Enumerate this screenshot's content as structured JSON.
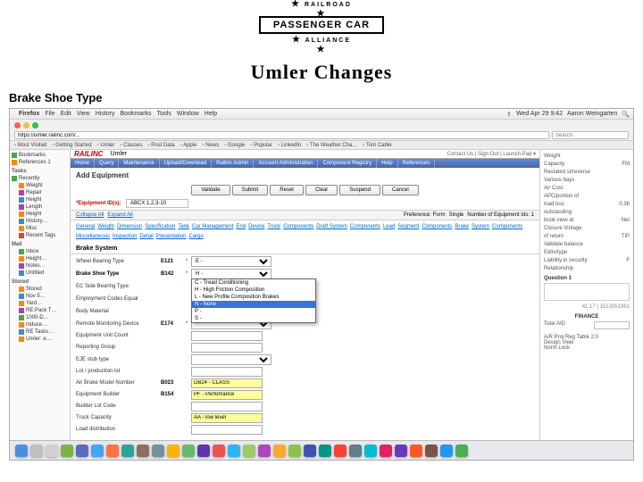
{
  "logo": {
    "top": "RAILROAD",
    "mid": "PASSENGER CAR",
    "bot": "ALLIANCE"
  },
  "title": "Umler Changes",
  "section_label": "Brake Shoe Type",
  "menubar": {
    "apple": "",
    "items": [
      "Firefox",
      "File",
      "Edit",
      "View",
      "History",
      "Bookmarks",
      "Tools",
      "Window",
      "Help"
    ],
    "right": {
      "time": "Wed Apr 29  9:42",
      "user": "Aaron Weingarten"
    }
  },
  "browser": {
    "url": "https://umler.railinc.com/...",
    "search_placeholder": "Search"
  },
  "bookmarks": [
    "Most Visited",
    "Getting Started",
    "Umler",
    "Classes",
    "Post Data",
    "Apple",
    "News",
    "Google",
    "Popular",
    "LinkedIn",
    "The Weather Cha…",
    "Tom Cable"
  ],
  "tree": [
    {
      "c": "green",
      "t": "Bookmarks"
    },
    {
      "c": "orange",
      "t": "References 1"
    },
    {
      "c": "",
      "t": "Tasks",
      "hdr": true
    },
    {
      "c": "green",
      "t": "Recently"
    },
    {
      "c": "orange",
      "t": "Weight",
      "i": 1
    },
    {
      "c": "purple",
      "t": "Repair",
      "i": 1
    },
    {
      "c": "blue",
      "t": "Height",
      "i": 1
    },
    {
      "c": "purple",
      "t": "Length",
      "i": 1
    },
    {
      "c": "orange",
      "t": "Height",
      "i": 1
    },
    {
      "c": "blue",
      "t": "History…",
      "i": 1
    },
    {
      "c": "orange",
      "t": "Misc",
      "i": 1
    },
    {
      "c": "red",
      "t": "Recent Tags",
      "i": 1
    },
    {
      "c": "",
      "t": "Mail",
      "hdr": true
    },
    {
      "c": "green",
      "t": "Inbox",
      "i": 1
    },
    {
      "c": "orange",
      "t": "Height…",
      "i": 1
    },
    {
      "c": "purple",
      "t": "Notes…",
      "i": 1
    },
    {
      "c": "blue",
      "t": "Untitled",
      "i": 1
    },
    {
      "c": "",
      "t": "Stored",
      "hdr": true
    },
    {
      "c": "orange",
      "t": "Stored",
      "i": 1
    },
    {
      "c": "blue",
      "t": "Nov 5…",
      "i": 1
    },
    {
      "c": "orange",
      "t": "Yard…",
      "i": 1
    },
    {
      "c": "purple",
      "t": "RE:Pack T…",
      "i": 1
    },
    {
      "c": "green",
      "t": "1000-D…",
      "i": 1
    },
    {
      "c": "orange",
      "t": "Induce…",
      "i": 1
    },
    {
      "c": "blue",
      "t": "RE Tasks…",
      "i": 1
    },
    {
      "c": "orange",
      "t": "Umler: e…",
      "i": 1
    }
  ],
  "rail": {
    "brand": "RAILINC",
    "page": "Umler",
    "crumbs": "Contact Us | Sign Out | Launch Pad ▾",
    "tabs": [
      "Home",
      "Query",
      "Maintenance",
      "Upload/Download",
      "Railinc Admin",
      "Account Administration",
      "Component Registry",
      "Help",
      "References"
    ],
    "heading": "Add Equipment",
    "equipment_label": "*Equipment ID(s):",
    "equipment_value": "ABCX 1,2,3-10",
    "btns": [
      "Validate",
      "Submit",
      "Reset",
      "Clear",
      "Suspend",
      "Cancel"
    ],
    "section_tabs": {
      "a": "Collapse All",
      "b": "Expand All",
      "c": "Preference: Form",
      "d": "Single",
      "e": "Number of Equipment Ids: 1"
    },
    "links1": [
      "General",
      "Weight",
      "Dimension",
      "Specification",
      "Tank",
      "Car Management",
      "End",
      "Device",
      "Truck",
      "Components",
      "Draft System",
      "Components",
      "Lead",
      "Segment",
      "Components",
      "Brake",
      "System",
      "Components"
    ],
    "links2": [
      "Miscellaneous",
      "Inspection",
      "Detail",
      "Presentation",
      "Cargo"
    ]
  },
  "form_rows": [
    {
      "l": "Wheel Bearing Type",
      "c": "E121",
      "r": true,
      "type": "select",
      "val": "E -"
    },
    {
      "l": "Brake Shoe Type",
      "c": "B142",
      "r": true,
      "type": "select",
      "val": "H -",
      "bold": true,
      "dropdown": true
    },
    {
      "l": "EC Side Bearing Type",
      "c": "",
      "r": false,
      "type": "select",
      "val": ""
    },
    {
      "l": "Employment Codes Equal",
      "c": "",
      "r": false,
      "type": "select",
      "val": ""
    },
    {
      "l": "Body Material",
      "c": "",
      "r": false,
      "type": "select",
      "val": ""
    },
    {
      "l": "Remote Monitoring Device",
      "c": "E174",
      "r": true,
      "type": "select",
      "val": ""
    },
    {
      "l": "Equipment Unit Count",
      "c": "",
      "r": false,
      "type": "input",
      "val": ""
    },
    {
      "l": "Reporting Group",
      "c": "",
      "r": false,
      "type": "input",
      "val": ""
    },
    {
      "l": "EJE stub type",
      "c": "",
      "r": false,
      "type": "select",
      "val": ""
    },
    {
      "l": "Lot / production lot",
      "c": "",
      "r": false,
      "type": "input",
      "val": ""
    },
    {
      "l": "Air Brake Model Number",
      "c": "B023",
      "r": false,
      "type": "input",
      "val": "DB24 - CLASS",
      "hi": true
    },
    {
      "l": "Equipment Builder",
      "c": "B154",
      "r": false,
      "type": "input",
      "val": "PF - Perfomance",
      "hi": true
    },
    {
      "l": "Builder Lot Code",
      "c": "",
      "r": false,
      "type": "input",
      "val": ""
    },
    {
      "l": "Truck Capacity",
      "c": "",
      "r": false,
      "type": "input",
      "val": "AA - low level",
      "hi": true
    },
    {
      "l": "Load distribution",
      "c": "",
      "r": false,
      "type": "input",
      "val": ""
    }
  ],
  "dropdown": [
    "C - Tread Conditioning",
    "H - High Friction Composition",
    "L - New Profile Composition Brakes",
    "N - None",
    "P -",
    "S -"
  ],
  "dropdown_sel": 3,
  "right_panel": {
    "rows1": [
      {
        "l": "Weight",
        "v": ""
      },
      {
        "l": "Capacity",
        "v": "FM"
      },
      {
        "l": "Restated st/reverse",
        "v": ""
      },
      {
        "l": "Various bays",
        "v": ""
      },
      {
        "l": "Air Cost",
        "v": ""
      },
      {
        "l": "APC/portion of",
        "v": ""
      },
      {
        "l": "load bus",
        "v": "0.36"
      },
      {
        "l": "outstanding",
        "v": ""
      },
      {
        "l": "book view at",
        "v": "Net"
      },
      {
        "l": "Closure Vintage",
        "v": ""
      },
      {
        "l": "of return",
        "v": "TIP"
      },
      {
        "l": "Validate balance",
        "v": ""
      },
      {
        "l": "Edits/type",
        "v": ""
      },
      {
        "l": "Liability in security",
        "v": "F"
      },
      {
        "l": "Relationship",
        "v": ""
      }
    ],
    "q": "Question 1",
    "finance": "FINANCE",
    "total": "Total AID",
    "footer": [
      "A/R Proj Reg Table 2.0",
      "Design View",
      "Norm Lock"
    ]
  },
  "dock_colors": [
    "#4a90e2",
    "#c0c0c0",
    "#d0d0d0",
    "#7cb342",
    "#5c6bc0",
    "#42a5f5",
    "#ff7043",
    "#26a69a",
    "#8d6e63",
    "#78909c",
    "#ffb300",
    "#66bb6a",
    "#5e35b1",
    "#ef5350",
    "#29b6f6",
    "#9ccc65",
    "#ab47bc",
    "#ffa726",
    "#8bc34a",
    "#3f51b5",
    "#009688",
    "#f44336",
    "#607d8b",
    "#00bcd4",
    "#e91e63",
    "#673ab7",
    "#ff5722",
    "#795548",
    "#2196f3",
    "#4caf50"
  ]
}
